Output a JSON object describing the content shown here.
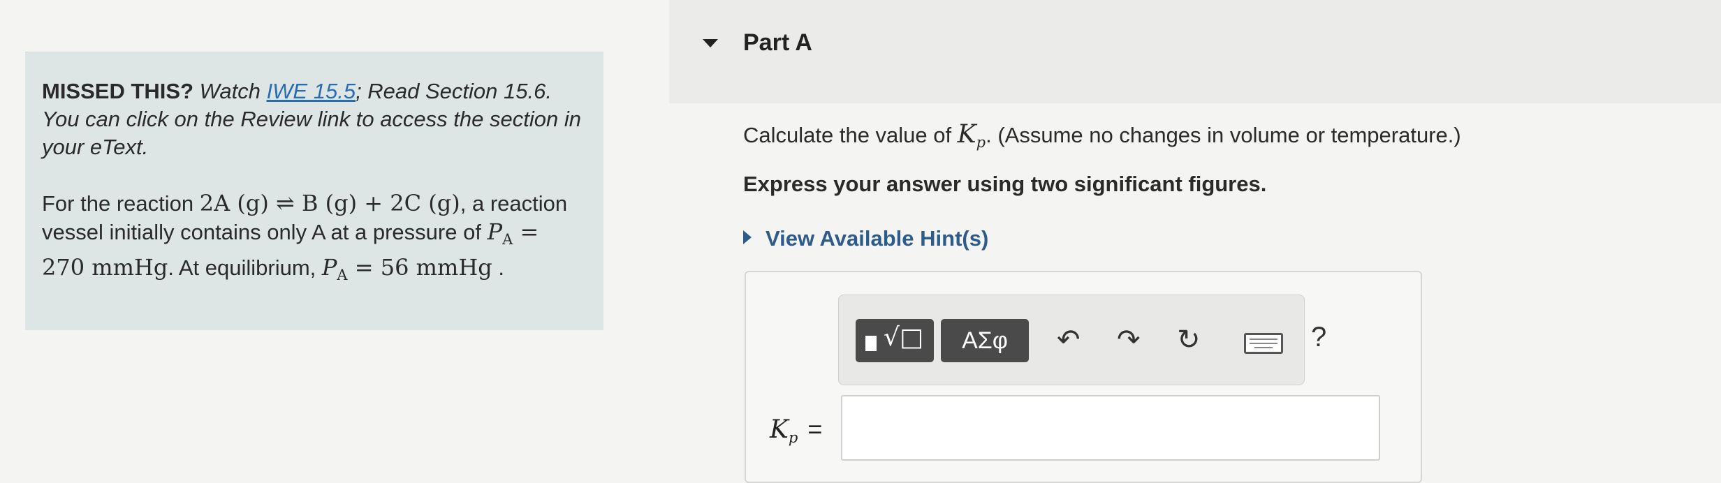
{
  "intro": {
    "missed": "MISSED THIS?",
    "watch": "Watch",
    "link": "IWE 15.5",
    "rest": "; Read Section 15.6. You can click on the Review link to access the section in your eText."
  },
  "problem": {
    "t1": "For the reaction",
    "reaction": "2A (g) ⇌ B (g) + 2C (g)",
    "t2": ", a reaction vessel initially contains only A at a pressure of",
    "p_symbol": "P",
    "p_sub": "A",
    "p_initial": " = 270 mmHg",
    "t3": ". At equilibrium,",
    "p_eq": " = 56 mmHg",
    "t4": "."
  },
  "part": {
    "title": "Part A"
  },
  "question": {
    "prefix": "Calculate the value of ",
    "k_symbol": "K",
    "k_sub": "p",
    "suffix": ". (Assume no changes in volume or temperature.)",
    "express": "Express your answer using two significant figures.",
    "hint": "View Available Hint(s)"
  },
  "toolbar": {
    "templates_glyph": "√□",
    "greek": "ΑΣφ",
    "undo_glyph": "↶",
    "redo_glyph": "↷",
    "reset_glyph": "↻",
    "help": "?"
  },
  "answer": {
    "k_symbol": "K",
    "k_sub": "p",
    "equals": "=",
    "value": ""
  }
}
